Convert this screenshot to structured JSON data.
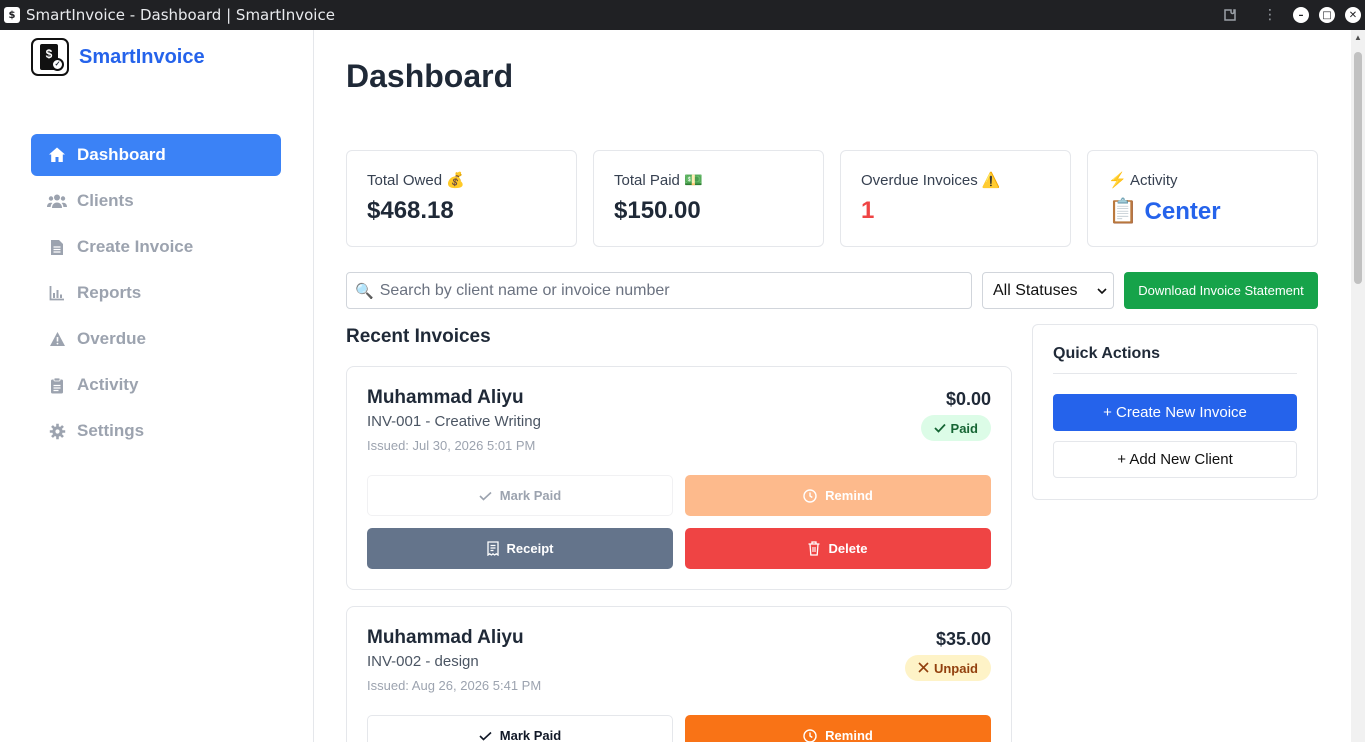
{
  "window": {
    "title": "SmartInvoice - Dashboard | SmartInvoice"
  },
  "brand": {
    "name": "SmartInvoice"
  },
  "sidebar": {
    "items": [
      {
        "label": "Dashboard",
        "icon": "home-icon",
        "active": true
      },
      {
        "label": "Clients",
        "icon": "users-icon"
      },
      {
        "label": "Create Invoice",
        "icon": "file-icon"
      },
      {
        "label": "Reports",
        "icon": "chart-icon"
      },
      {
        "label": "Overdue",
        "icon": "warning-icon"
      },
      {
        "label": "Activity",
        "icon": "clipboard-icon"
      },
      {
        "label": "Settings",
        "icon": "gear-icon"
      }
    ]
  },
  "main": {
    "title": "Dashboard",
    "stats": [
      {
        "label": "Total Owed 💰",
        "value": "$468.18"
      },
      {
        "label": "Total Paid 💵",
        "value": "$150.00"
      },
      {
        "label": "Overdue Invoices ⚠️",
        "value": "1"
      },
      {
        "label": "⚡ Activity",
        "value": "📋 Center"
      }
    ],
    "search": {
      "placeholder": "Search by client name or invoice number"
    },
    "status_filter": {
      "selected": "All Statuses"
    },
    "download_label": "Download Invoice Statement",
    "recent_title": "Recent Invoices",
    "invoices": [
      {
        "client": "Muhammad Aliyu",
        "desc": "INV-001 - Creative Writing",
        "issued": "Issued: Jul 30, 2026 5:01 PM",
        "amount": "$0.00",
        "status": "Paid",
        "mark_paid": "Mark Paid",
        "remind": "Remind",
        "receipt": "Receipt",
        "delete": "Delete"
      },
      {
        "client": "Muhammad Aliyu",
        "desc": "INV-002 - design",
        "issued": "Issued: Aug 26, 2026 5:41 PM",
        "amount": "$35.00",
        "status": "Unpaid",
        "mark_paid": "Mark Paid",
        "remind": "Remind"
      }
    ],
    "quick_actions": {
      "title": "Quick Actions",
      "create": "+ Create New Invoice",
      "add_client": "+ Add New Client"
    }
  },
  "colors": {
    "brand": "#2563eb",
    "active_nav": "#3b82f6",
    "download": "#16a34a",
    "danger": "#ef4444",
    "remind": "#f97316"
  }
}
